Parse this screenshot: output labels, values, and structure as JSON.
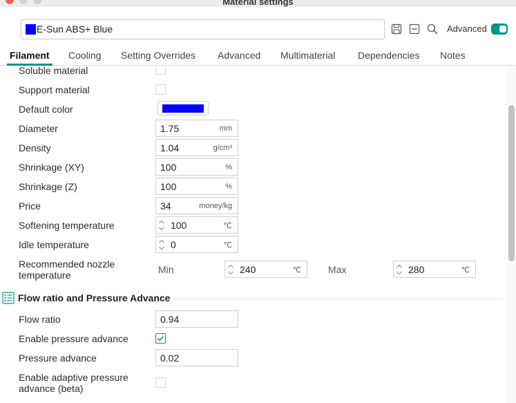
{
  "window": {
    "title": "Material settings"
  },
  "preset": {
    "name": "E-Sun ABS+ Blue",
    "swatch_color": "#0000ff"
  },
  "toolbar": {
    "icons": [
      "save-icon",
      "collapse-icon",
      "search-icon"
    ],
    "advanced_label": "Advanced",
    "advanced_on": true,
    "accent_color": "#009688"
  },
  "tabs": [
    {
      "label": "Filament",
      "active": true
    },
    {
      "label": "Cooling"
    },
    {
      "label": "Setting Overrides"
    },
    {
      "label": "Advanced"
    },
    {
      "label": "Multimaterial"
    },
    {
      "label": "Dependencies"
    },
    {
      "label": "Notes"
    }
  ],
  "filament": {
    "soluble_label": "Soluble material",
    "soluble": false,
    "support_label": "Support material",
    "support": false,
    "default_color_label": "Default color",
    "default_color": "#0000ff",
    "diameter_label": "Diameter",
    "diameter": "1.75",
    "diameter_unit": "mm",
    "density_label": "Density",
    "density": "1.04",
    "density_unit": "g/cm³",
    "shrink_xy_label": "Shrinkage (XY)",
    "shrink_xy": "100",
    "shrink_xy_unit": "%",
    "shrink_z_label": "Shrinkage (Z)",
    "shrink_z": "100",
    "shrink_z_unit": "%",
    "price_label": "Price",
    "price": "34",
    "price_unit": "money/kg",
    "softening_label": "Softening temperature",
    "softening": "100",
    "softening_unit": "℃",
    "idle_label": "Idle temperature",
    "idle": "0",
    "idle_unit": "℃",
    "nozzle_label_1": "Recommended nozzle",
    "nozzle_label_2": "temperature",
    "nozzle_min_label": "Min",
    "nozzle_min": "240",
    "nozzle_min_unit": "℃",
    "nozzle_max_label": "Max",
    "nozzle_max": "280",
    "nozzle_max_unit": "℃"
  },
  "flow_section": {
    "title": "Flow ratio and Pressure Advance",
    "flow_ratio_label": "Flow ratio",
    "flow_ratio": "0.94",
    "enable_pa_label": "Enable pressure advance",
    "enable_pa": true,
    "pa_label": "Pressure advance",
    "pa": "0.02",
    "adaptive_label_1": "Enable adaptive pressure",
    "adaptive_label_2": "advance (beta)",
    "adaptive": false
  }
}
